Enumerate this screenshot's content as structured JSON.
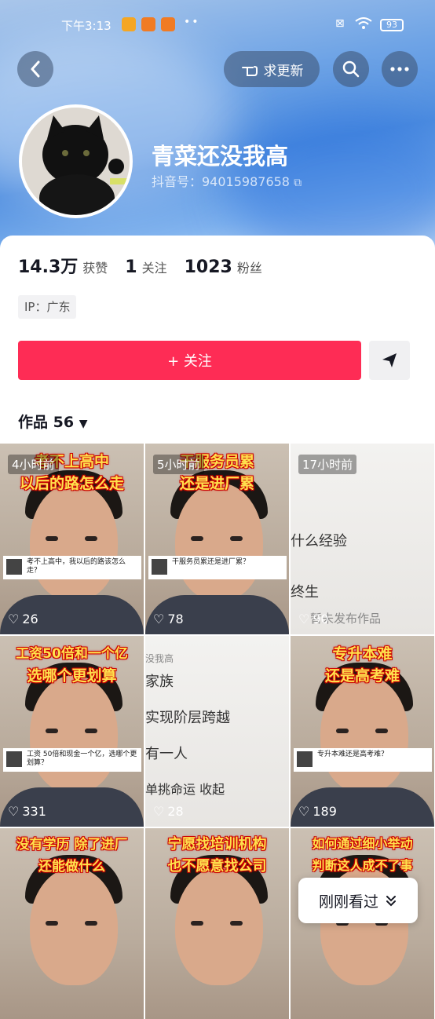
{
  "status_bar": {
    "time": "下午3:13",
    "battery": "93"
  },
  "header": {
    "request_update_label": "求更新"
  },
  "profile": {
    "name": "青菜还没我高",
    "douyin_id": "抖音号：94015987658",
    "likes_value": "14.3万",
    "likes_label": "获赞",
    "following_value": "1",
    "following_label": "关注",
    "followers_value": "1023",
    "followers_label": "粉丝",
    "ip": "IP：广东",
    "follow_label": "+ 关注"
  },
  "works": {
    "label": "作品 56"
  },
  "videos": [
    {
      "time": "4小时前",
      "cap1": "考不上高中",
      "cap2": "以后的路怎么走",
      "question": "考不上高中，我以后的路该怎么走？",
      "likes": "26"
    },
    {
      "time": "5小时前",
      "cap1": "干服务员累",
      "cap2": "还是进厂累",
      "question": "干服务员累还是进厂累？",
      "likes": "78"
    },
    {
      "time": "17小时前",
      "text_lines": [
        "什么经验",
        "终生"
      ],
      "note": "暂未发布作品",
      "likes": "90"
    },
    {
      "cap1": "工资50倍和一个亿",
      "cap2": "选哪个更划算",
      "question": "工资 50倍和现金一个亿，选哪个更划算？",
      "likes": "331"
    },
    {
      "text_lines": [
        "没我高",
        "家族",
        "实现阶层跨越",
        "有一人",
        "单挑命运 收起"
      ],
      "likes": "28"
    },
    {
      "cap1": "专升本难",
      "cap2": "还是高考难",
      "question": "专升本难还是高考难？",
      "likes": "189"
    },
    {
      "cap1": "没有学历 除了进厂",
      "cap2": "还能做什么"
    },
    {
      "cap1": "宁愿找培训机构",
      "cap2": "也不愿意找公司"
    },
    {
      "cap1": "如何通过细小举动",
      "cap2": "判断这人成不了事"
    }
  ],
  "recently_viewed": {
    "label": "刚刚看过"
  },
  "colors": {
    "accent": "#fe2c55"
  }
}
